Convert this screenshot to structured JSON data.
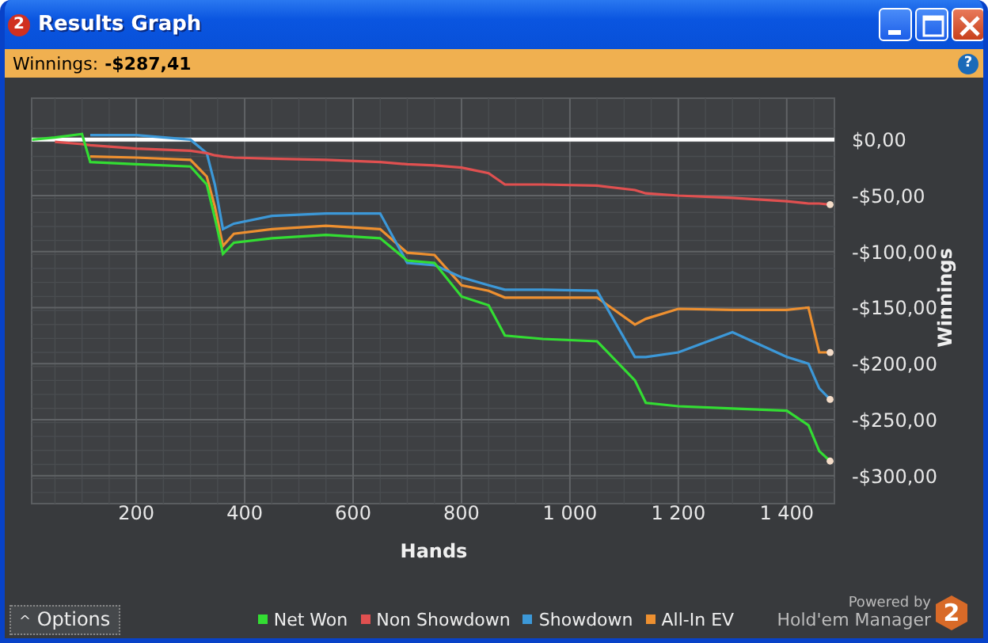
{
  "window": {
    "title": "Results Graph",
    "icon_label": "2"
  },
  "summary": {
    "label": "Winnings:",
    "value": "-$287,41",
    "help": "?"
  },
  "chart": {
    "chart_data": {
      "type": "line",
      "grid": true,
      "xlabel": "Hands",
      "ylabel": "Winnings",
      "xlim": [
        7,
        1488
      ],
      "ylim": [
        -325,
        37
      ],
      "xticks": [
        {
          "value": 200,
          "label": "200"
        },
        {
          "value": 400,
          "label": "400"
        },
        {
          "value": 600,
          "label": "600"
        },
        {
          "value": 800,
          "label": "800"
        },
        {
          "value": 1000,
          "label": "1 000"
        },
        {
          "value": 1200,
          "label": "1 200"
        },
        {
          "value": 1400,
          "label": "1 400"
        }
      ],
      "yticks": [
        {
          "value": 0,
          "label": "$0,00"
        },
        {
          "value": -50,
          "label": "-$50,00"
        },
        {
          "value": -100,
          "label": "-$100,00"
        },
        {
          "value": -150,
          "label": "-$150,00"
        },
        {
          "value": -200,
          "label": "-$200,00"
        },
        {
          "value": -250,
          "label": "-$250,00"
        },
        {
          "value": -300,
          "label": "-$300,00"
        }
      ],
      "x": [
        8,
        50,
        100,
        115,
        200,
        300,
        330,
        345,
        360,
        380,
        450,
        550,
        650,
        700,
        750,
        800,
        850,
        880,
        950,
        1050,
        1120,
        1140,
        1200,
        1300,
        1400,
        1440,
        1460,
        1480
      ],
      "series": [
        {
          "name": "Net Won",
          "color": "#33dd33",
          "values": [
            0,
            2,
            5,
            -20,
            -22,
            -24,
            -40,
            -70,
            -102,
            -92,
            -88,
            -85,
            -88,
            -108,
            -110,
            -140,
            -148,
            -175,
            -178,
            -180,
            -215,
            -235,
            -238,
            -240,
            -242,
            -255,
            -278,
            -287
          ]
        },
        {
          "name": "Non Showdown",
          "color": "#e05050",
          "values": [
            null,
            -2,
            -4,
            -5,
            -8,
            -10,
            -12,
            -14,
            -15,
            -16,
            -17,
            -18,
            -20,
            -22,
            -23,
            -25,
            -30,
            -40,
            -40,
            -41,
            -45,
            -48,
            -50,
            -52,
            -55,
            -57,
            -57,
            -58
          ]
        },
        {
          "name": "Showdown",
          "color": "#3c98d8",
          "values": [
            null,
            null,
            null,
            4,
            4,
            0,
            -12,
            -40,
            -80,
            -75,
            -68,
            -66,
            -66,
            -110,
            -112,
            -123,
            -130,
            -134,
            -134,
            -135,
            -194,
            -194,
            -190,
            -172,
            -194,
            -200,
            -222,
            -232
          ]
        },
        {
          "name": "All-In EV",
          "color": "#ee9030",
          "values": [
            null,
            null,
            null,
            -15,
            -16,
            -18,
            -33,
            -60,
            -95,
            -84,
            -80,
            -77,
            -80,
            -101,
            -103,
            -130,
            -135,
            -141,
            -141,
            -141,
            -165,
            -160,
            -151,
            -152,
            -152,
            -150,
            -190,
            -190
          ]
        }
      ]
    }
  },
  "footer": {
    "options_glyph": "^",
    "options_label": "Options",
    "powered_by": "Powered by",
    "brand": "Hold'em Manager",
    "brand_mark": "2"
  }
}
